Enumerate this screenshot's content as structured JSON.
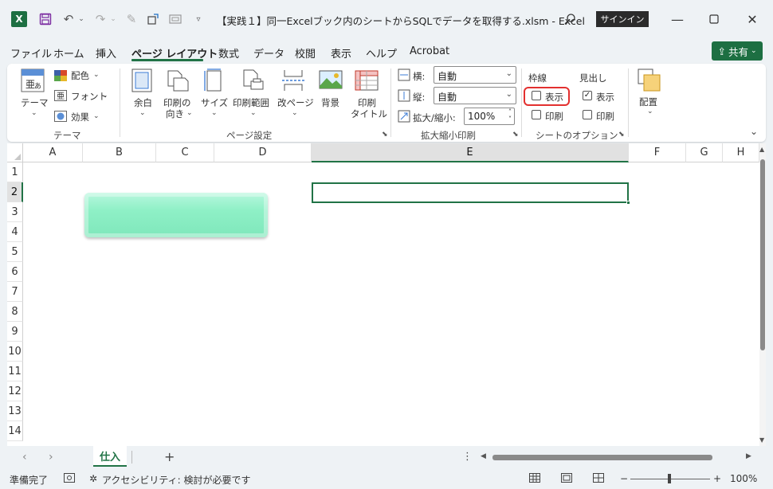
{
  "titlebar": {
    "logo_letter": "X",
    "doc_title": "【実践１】同一Excelブック内のシートからSQLでデータを取得する.xlsm  -  Excel",
    "signin_label": "サインイン",
    "icons": [
      "save-icon",
      "undo-icon",
      "redo-icon",
      "draw-icon",
      "shape-icon",
      "camera-icon",
      "customize-qat-icon",
      "search-icon",
      "minimize-icon",
      "maximize-icon",
      "close-icon"
    ]
  },
  "menu": {
    "tabs": [
      "ファイル",
      "ホーム",
      "挿入",
      "ページ レイアウト",
      "数式",
      "データ",
      "校閲",
      "表示",
      "ヘルプ",
      "Acrobat"
    ],
    "active_tab": "ページ レイアウト",
    "share_label": "共有"
  },
  "ribbon": {
    "theme": {
      "theme_label": "テーマ",
      "colors_label": "配色",
      "fonts_label": "フォント",
      "effects_label": "効果",
      "group_label": "テーマ"
    },
    "page_setup": {
      "margins_label": "余白",
      "orientation_label1": "印刷の",
      "orientation_label2": "向き",
      "size_label": "サイズ",
      "print_area_label": "印刷範囲",
      "breaks_label": "改ページ",
      "background_label": "背景",
      "print_titles_label1": "印刷",
      "print_titles_label2": "タイトル",
      "group_label": "ページ設定"
    },
    "scale": {
      "width_label": "横:",
      "width_value": "自動",
      "height_label": "縦:",
      "height_value": "自動",
      "scale_label": "拡大/縮小:",
      "scale_value": "100%",
      "group_label": "拡大縮小印刷"
    },
    "sheet_options": {
      "gridlines_label": "枠線",
      "gridlines_view_label": "表示",
      "gridlines_view_checked": false,
      "gridlines_print_label": "印刷",
      "gridlines_print_checked": false,
      "headings_label": "見出し",
      "headings_view_label": "表示",
      "headings_view_checked": true,
      "headings_print_label": "印刷",
      "headings_print_checked": false,
      "group_label": "シートのオプション"
    },
    "arrange": {
      "arrange_label": "配置"
    },
    "highlight_color": "#e3302f"
  },
  "sheet": {
    "columns": [
      "A",
      "B",
      "C",
      "D",
      "E",
      "F",
      "G",
      "H"
    ],
    "selected_column": "E",
    "rows": [
      "1",
      "2",
      "3",
      "4",
      "5",
      "6",
      "7",
      "8",
      "9",
      "10",
      "11",
      "12",
      "13",
      "14"
    ],
    "selected_row": "2",
    "shape_color": "#8ef0c6",
    "accent_color": "#217346"
  },
  "sheet_tabs": {
    "active_tab": "仕入",
    "add_label": "+",
    "more_label": "⋮"
  },
  "status": {
    "ready_label": "準備完了",
    "accessibility_label": "アクセシビリティ: 検討が必要です",
    "zoom_minus": "−",
    "zoom_plus": "+",
    "zoom_level": "100%"
  }
}
